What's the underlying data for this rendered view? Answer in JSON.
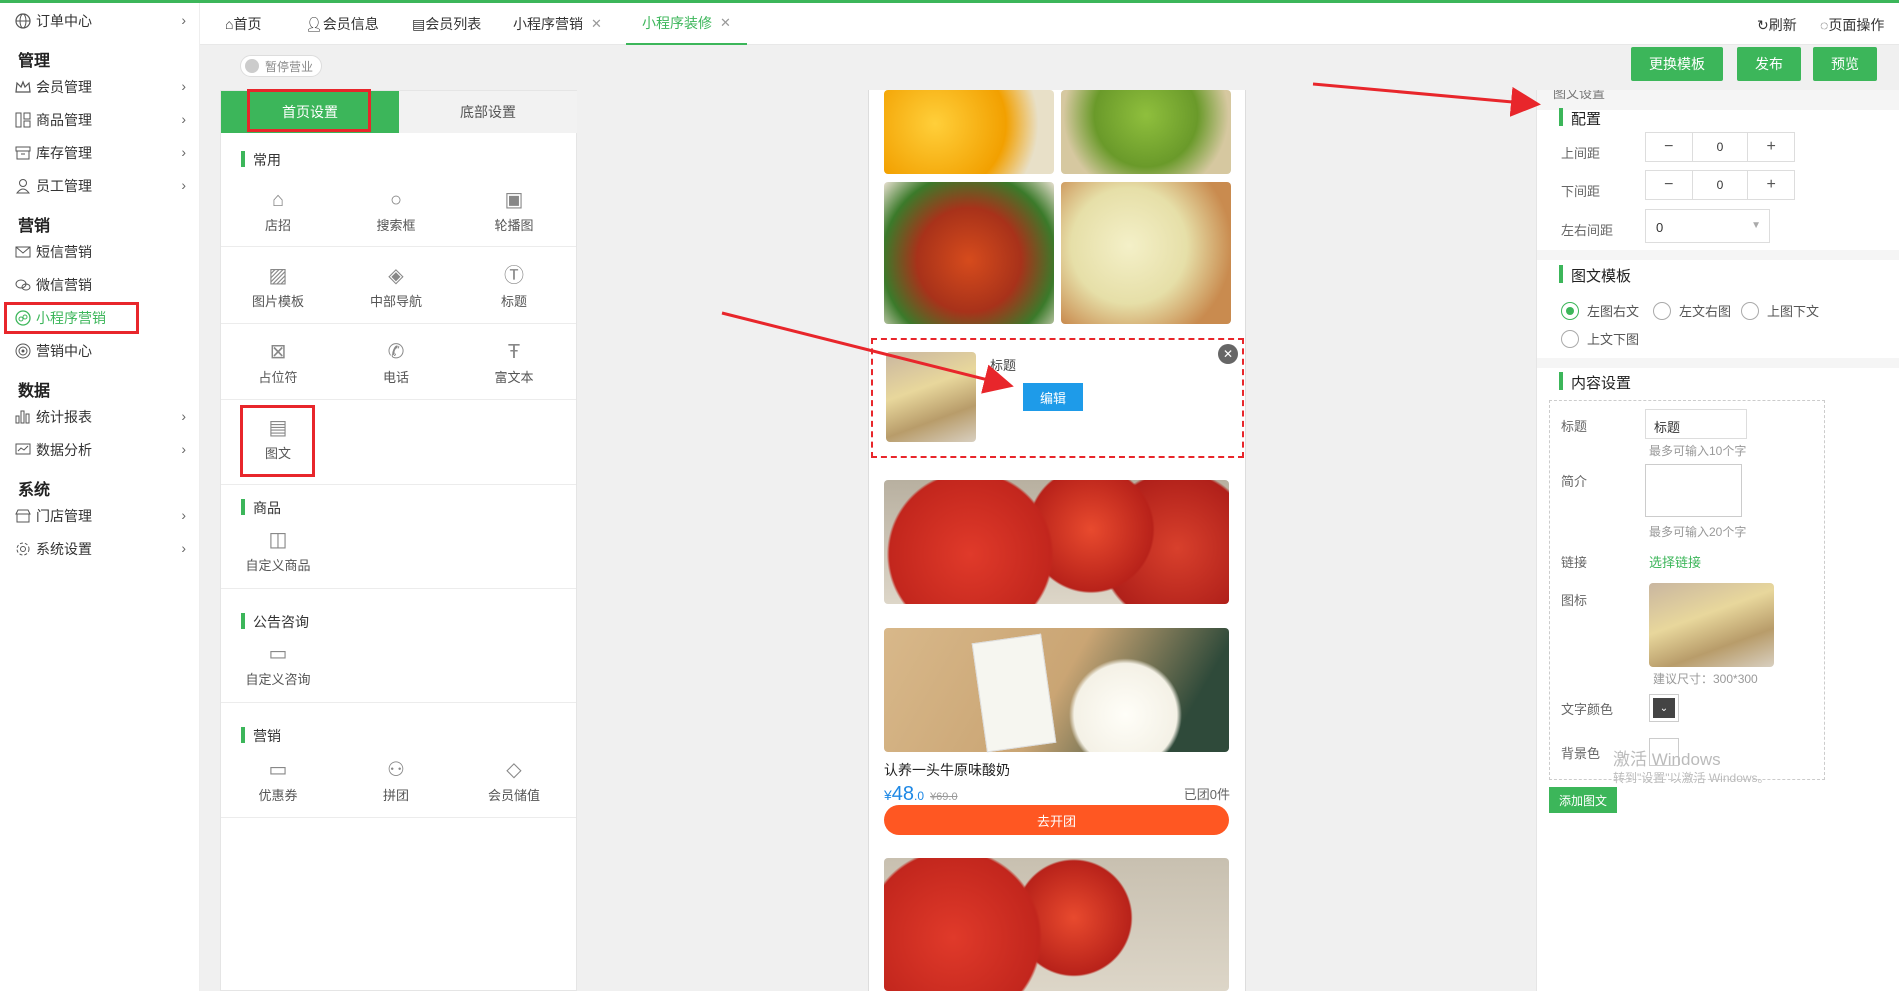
{
  "sidebar": {
    "top_item": "订单中心",
    "groups": [
      {
        "heading": "管理"
      },
      {
        "heading": "营销"
      },
      {
        "heading": "数据"
      },
      {
        "heading": "系统"
      }
    ],
    "items": {
      "member": "会员管理",
      "goods": "商品管理",
      "stock": "库存管理",
      "staff": "员工管理",
      "sms": "短信营销",
      "wechat": "微信营销",
      "miniapp": "小程序营销",
      "center": "营销中心",
      "report": "统计报表",
      "analysis": "数据分析",
      "store": "门店管理",
      "settings": "系统设置"
    }
  },
  "tabs": {
    "home": "首页",
    "member_info": "会员信息",
    "member_list": "会员列表",
    "mini_marketing": "小程序营销",
    "mini_decorate": "小程序装修",
    "refresh": "刷新",
    "page_ops": "页面操作"
  },
  "toolbar": {
    "paused": "暂停营业",
    "change_template": "更换模板",
    "publish": "发布",
    "preview": "预览"
  },
  "components": {
    "tab_home": "首页设置",
    "tab_bottom": "底部设置",
    "common": "常用",
    "common_items": [
      "店招",
      "搜索框",
      "轮播图",
      "图片模板",
      "中部导航",
      "标题",
      "占位符",
      "电话",
      "富文本",
      "图文"
    ],
    "goods": "商品",
    "custom_goods": "自定义商品",
    "notice": "公告咨询",
    "custom_notice": "自定义咨询",
    "marketing": "营销",
    "marketing_items": [
      "优惠券",
      "拼团",
      "会员储值"
    ]
  },
  "preview": {
    "card_title": "标题",
    "edit": "编辑",
    "product_name": "认养一头牛原味酸奶",
    "price_symbol": "¥",
    "price": "48",
    "price_dec": ".0",
    "orig_price": "¥69.0",
    "sold": "已团0件",
    "group_btn": "去开团"
  },
  "settings": {
    "header": "图文设置",
    "config": "配置",
    "top_margin": "上间距",
    "top_value": "0",
    "bottom_margin": "下间距",
    "bottom_value": "0",
    "side_margin": "左右间距",
    "side_value": "0",
    "template": "图文模板",
    "templates": [
      "左图右文",
      "左文右图",
      "上图下文",
      "上文下图"
    ],
    "content": "内容设置",
    "title_label": "标题",
    "title_value": "标题",
    "title_hint": "最多可输入10个字",
    "intro_label": "简介",
    "intro_hint": "最多可输入20个字",
    "link_label": "链接",
    "link_value": "选择链接",
    "icon_label": "图标",
    "icon_hint": "建议尺寸：300*300",
    "text_color": "文字颜色",
    "bg_color": "背景色",
    "add_btn": "添加图文",
    "watermark1": "激活 Windows",
    "watermark2": "转到\"设置\"以激活 Windows。"
  },
  "colors": {
    "accent": "#3cb65a",
    "highlight": "#e8262b",
    "price": "#1e88e5",
    "group_btn": "#ff5722"
  }
}
